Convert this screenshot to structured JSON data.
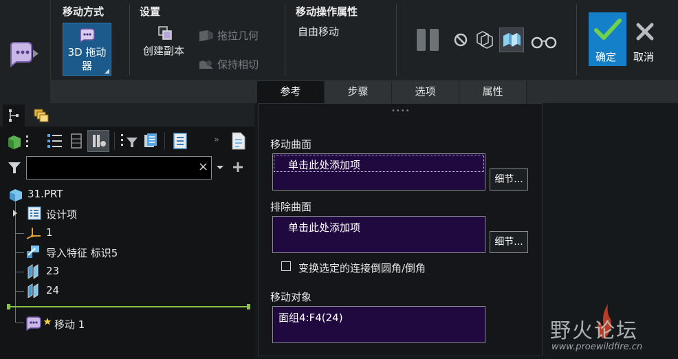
{
  "ribbon": {
    "move_method": {
      "title": "移动方式",
      "drag_3d_label": "3D 拖动器"
    },
    "settings": {
      "title": "设置",
      "create_copy": "创建副本",
      "drag_geometry": "拖拉几何",
      "keep_tangent": "保持相切"
    },
    "move_props": {
      "title": "移动操作属性",
      "free_move": "自由移动"
    },
    "actions": {
      "confirm": "确定",
      "cancel": "取消"
    }
  },
  "tabs": [
    {
      "label": "参考",
      "active": true
    },
    {
      "label": "步骤",
      "active": false
    },
    {
      "label": "选项",
      "active": false
    },
    {
      "label": "属性",
      "active": false
    }
  ],
  "model_tree": {
    "search": {
      "value": "",
      "placeholder": ""
    },
    "items": [
      {
        "label": "31.PRT"
      },
      {
        "label": "设计项"
      },
      {
        "label": "1"
      },
      {
        "label": "导入特征 标识5"
      },
      {
        "label": "23"
      },
      {
        "label": "24"
      },
      {
        "label": "移动 1"
      }
    ]
  },
  "references": {
    "move_surfaces": {
      "label": "移动曲面",
      "placeholder": "单击此处添加项",
      "details": "细节..."
    },
    "exclude_surfaces": {
      "label": "排除曲面",
      "placeholder": "单击此处添加项",
      "details": "细节..."
    },
    "transform_checkbox": {
      "label": "变换选定的连接倒圆角/倒角",
      "checked": false
    },
    "move_objects": {
      "label": "移动对象",
      "value": "面组4:F4(24)"
    }
  },
  "watermark": {
    "title": "野火论坛",
    "url": "www.proewildfire.cn"
  },
  "colors": {
    "accent": "#1480c9",
    "list_bg": "#20093f",
    "tree_divider": "#8bc34a"
  }
}
